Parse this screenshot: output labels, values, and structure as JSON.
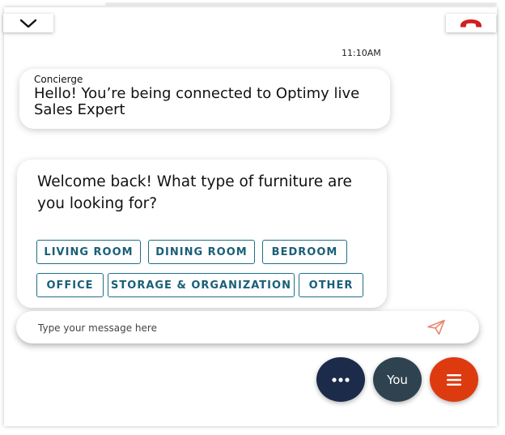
{
  "header": {
    "collapse_icon": "chevron-down-icon",
    "hangup_icon": "phone-hangup-icon",
    "hangup_color": "#d01f1f"
  },
  "chat": {
    "timestamp": "11:10AM",
    "messages": [
      {
        "sender": "Concierge",
        "text": "Hello! You’re being connected to Optimy live Sales Expert"
      },
      {
        "sender": "",
        "text": "Welcome back! What type of furniture are you looking for?"
      }
    ],
    "options": [
      "LIVING ROOM",
      "DINING ROOM",
      "BEDROOM",
      "OFFICE",
      "STORAGE & ORGANIZATION",
      "OTHER"
    ]
  },
  "composer": {
    "placeholder": "Type your message here",
    "send_icon": "paper-plane-icon",
    "send_color": "#e8846e"
  },
  "actions": {
    "more_icon": "ellipsis-icon",
    "you_label": "You",
    "menu_icon": "hamburger-menu-icon",
    "colors": {
      "more": "#1d2b4a",
      "you": "#2e4250",
      "menu": "#de3a10"
    }
  }
}
